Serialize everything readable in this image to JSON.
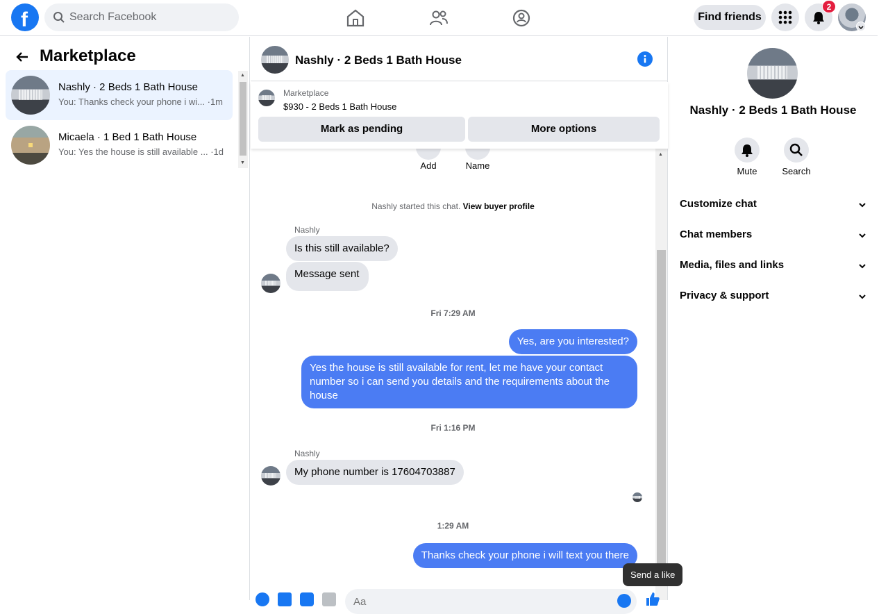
{
  "topbar": {
    "search_placeholder": "Search Facebook",
    "find_friends": "Find friends",
    "notification_count": "2"
  },
  "left": {
    "title": "Marketplace",
    "conversations": [
      {
        "name": "Nashly · 2 Beds 1 Bath House",
        "preview": "You: Thanks check your phone i wi... ·1m"
      },
      {
        "name": "Micaela · 1 Bed 1 Bath House",
        "preview": "You: Yes the house is still available ... ·1d"
      }
    ]
  },
  "chat": {
    "title": "Nashly · 2 Beds 1 Bath House",
    "listing": {
      "source": "Marketplace",
      "price_title": "$930 - 2 Beds 1 Bath House",
      "mark_pending": "Mark as pending",
      "more_options": "More options"
    },
    "actions": {
      "add": "Add",
      "name": "Name"
    },
    "system_note": {
      "text": "Nashly started this chat.",
      "link": "View buyer profile"
    },
    "messages": [
      {
        "sender": "Nashly"
      },
      {
        "text": "Is this still available?"
      },
      {
        "text": "Message sent"
      },
      {
        "timestamp": "Fri 7:29 AM"
      },
      {
        "text": "Yes, are you interested?"
      },
      {
        "text": "Yes the house is still available for rent, let me have your contact number so i can send you details and the requirements about the house"
      },
      {
        "timestamp": "Fri 1:16 PM"
      },
      {
        "sender": "Nashly"
      },
      {
        "text": "My phone number is 17604703887"
      },
      {
        "timestamp": "1:29 AM"
      },
      {
        "text": "Thanks check your phone i will text you there"
      }
    ],
    "composer_placeholder": "Aa",
    "tooltip": "Send a like"
  },
  "right": {
    "title": "Nashly · 2 Beds 1 Bath House",
    "actions": {
      "mute": "Mute",
      "search": "Search"
    },
    "sections": [
      "Customize chat",
      "Chat members",
      "Media, files and links",
      "Privacy & support"
    ]
  },
  "colors": {
    "brand": "#1877f2",
    "outgoing_bubble": "#4b7cf3",
    "incoming_bubble": "#e4e6eb"
  }
}
